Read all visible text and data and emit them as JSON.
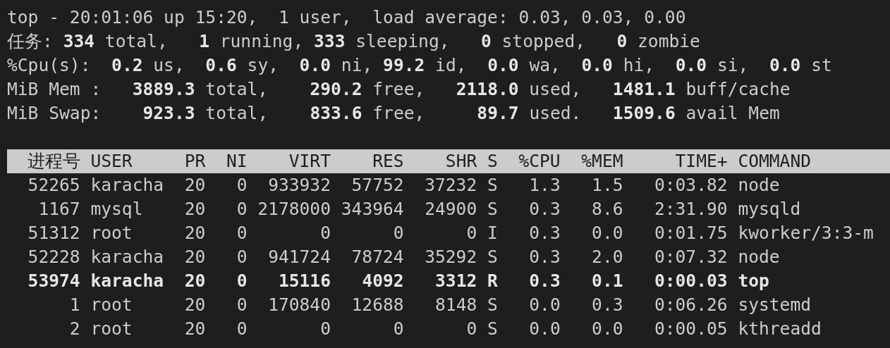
{
  "summary_lines": [
    "top - 20:01:06 up 15:20,  1 user,  load average: 0.03, 0.03, 0.00",
    "任务: **334** total,   **1** running, **333** sleeping,   **0** stopped,   **0** zombie",
    "%Cpu(s):  **0.2** us,  **0.6** sy,  **0.0** ni, **99.2** id,  **0.0** wa,  **0.0** hi,  **0.0** si,  **0.0** st",
    "MiB Mem :   **3889.3** total,    **290.2** free,   **2118.0** used,   **1481.1** buff/cache",
    "MiB Swap:    **923.3** total,    **833.6** free,     **89.7** used.   **1509.6** avail Mem"
  ],
  "table": {
    "columns": [
      "进程号",
      "USER",
      "PR",
      "NI",
      "VIRT",
      "RES",
      "SHR",
      "S",
      "%CPU",
      "%MEM",
      "TIME+",
      "COMMAND"
    ],
    "rows": [
      {
        "highlighted": false,
        "cells": [
          "52265",
          "karacha",
          "20",
          "0",
          "933932",
          "57752",
          "37232",
          "S",
          "1.3",
          "1.5",
          "0:03.82",
          "node"
        ]
      },
      {
        "highlighted": false,
        "cells": [
          "1167",
          "mysql",
          "20",
          "0",
          "2178000",
          "343964",
          "24900",
          "S",
          "0.3",
          "8.6",
          "2:31.90",
          "mysqld"
        ]
      },
      {
        "highlighted": false,
        "cells": [
          "51312",
          "root",
          "20",
          "0",
          "0",
          "0",
          "0",
          "I",
          "0.3",
          "0.0",
          "0:01.75",
          "kworker/3:3-m"
        ]
      },
      {
        "highlighted": false,
        "cells": [
          "52228",
          "karacha",
          "20",
          "0",
          "941724",
          "78724",
          "35292",
          "S",
          "0.3",
          "2.0",
          "0:07.32",
          "node"
        ]
      },
      {
        "highlighted": true,
        "cells": [
          "53974",
          "karacha",
          "20",
          "0",
          "15116",
          "4092",
          "3312",
          "R",
          "0.3",
          "0.1",
          "0:00.03",
          "top"
        ]
      },
      {
        "highlighted": false,
        "cells": [
          "1",
          "root",
          "20",
          "0",
          "170840",
          "12688",
          "8148",
          "S",
          "0.0",
          "0.3",
          "0:06.26",
          "systemd"
        ]
      },
      {
        "highlighted": false,
        "cells": [
          "2",
          "root",
          "20",
          "0",
          "0",
          "0",
          "0",
          "S",
          "0.0",
          "0.0",
          "0:00.05",
          "kthreadd"
        ]
      }
    ]
  }
}
